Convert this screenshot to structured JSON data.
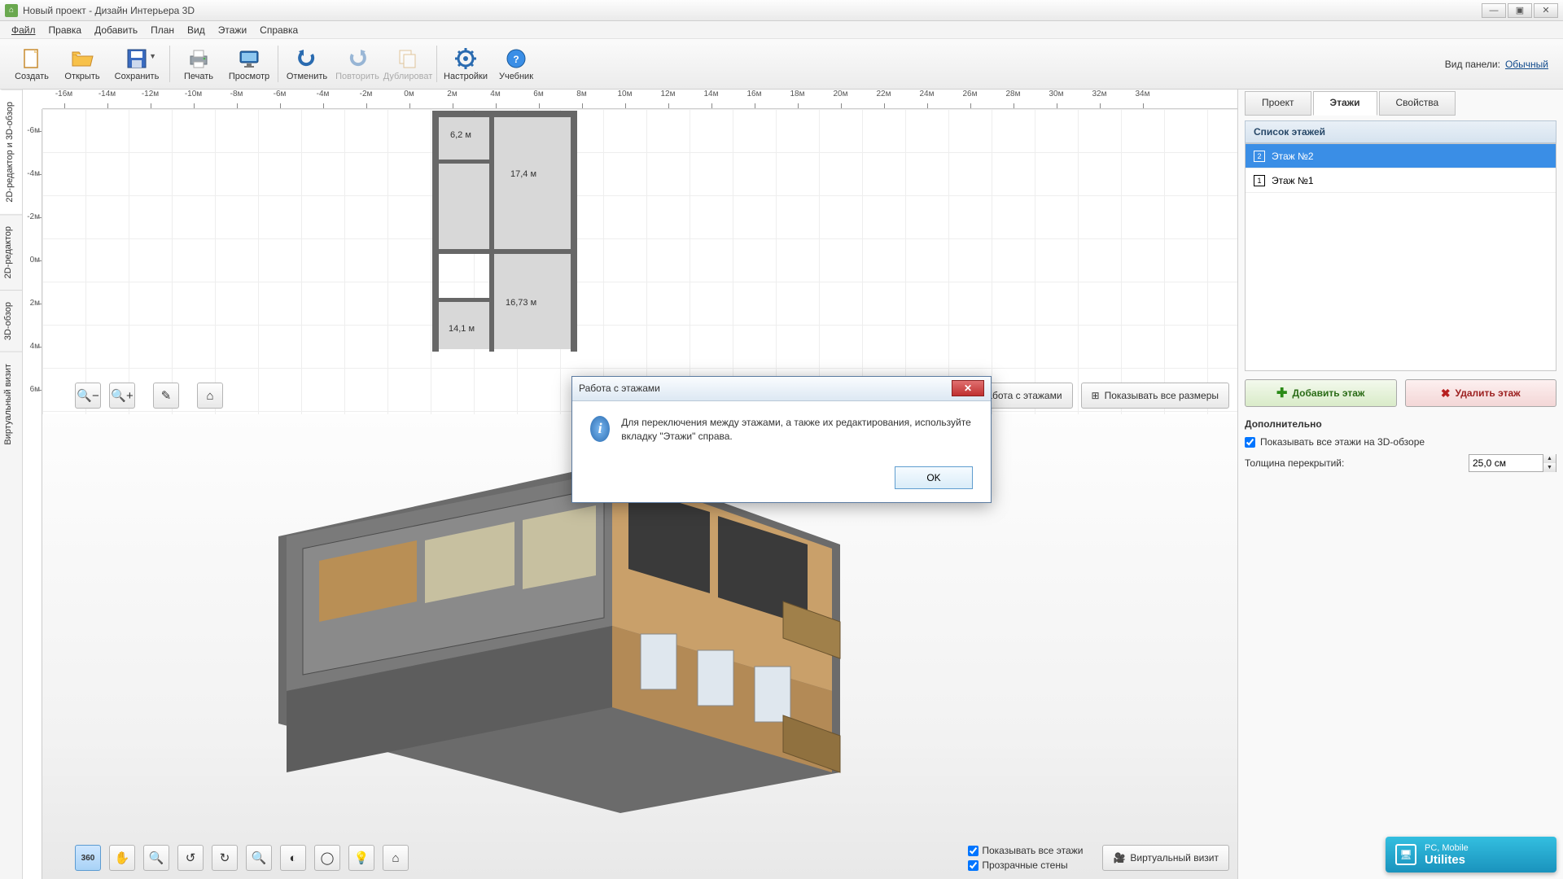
{
  "title": "Новый проект - Дизайн Интерьера 3D",
  "menu": {
    "file": "Файл",
    "edit": "Правка",
    "add": "Добавить",
    "plan": "План",
    "view": "Вид",
    "floors": "Этажи",
    "help": "Справка"
  },
  "toolbar": {
    "create": "Создать",
    "open": "Открыть",
    "save": "Сохранить",
    "print": "Печать",
    "preview": "Просмотр",
    "undo": "Отменить",
    "redo": "Повторить",
    "duplicate": "Дублироват",
    "settings": "Настройки",
    "tutorial": "Учебник",
    "panel_label": "Вид панели:",
    "panel_mode": "Обычный"
  },
  "left_tabs": [
    "2D-редактор и 3D-обзор",
    "2D-редактор",
    "3D-обзор",
    "Виртуальный визит"
  ],
  "ruler_h": [
    "-16м",
    "-14м",
    "-12м",
    "-10м",
    "-8м",
    "-6м",
    "-4м",
    "-2м",
    "0м",
    "2м",
    "4м",
    "6м",
    "8м",
    "10м",
    "12м",
    "14м",
    "16м",
    "18м",
    "20м",
    "22м",
    "24м",
    "26м",
    "28м",
    "30м",
    "32м",
    "34м"
  ],
  "ruler_v": [
    "-6м",
    "-4м",
    "-2м",
    "0м",
    "2м",
    "4м",
    "6м"
  ],
  "rooms": {
    "r1": "6,2 м",
    "r2": "17,4 м",
    "r3": "14,1 м",
    "r4": "16,73 м"
  },
  "overlay2d": {
    "floors_btn": "Работа с этажами",
    "dims_btn": "Показывать все размеры"
  },
  "overlay3d": {
    "show_all": "Показывать все этажи",
    "transparent": "Прозрачные стены",
    "virtual": "Виртуальный визит"
  },
  "right": {
    "tabs": {
      "project": "Проект",
      "floors": "Этажи",
      "props": "Свойства"
    },
    "list_header": "Список этажей",
    "items": [
      {
        "label": "Этаж №2"
      },
      {
        "label": "Этаж №1"
      }
    ],
    "add": "Добавить этаж",
    "del": "Удалить этаж",
    "extra_h": "Дополнительно",
    "show3d": "Показывать все этажи на 3D-обзоре",
    "thickness_label": "Толщина перекрытий:",
    "thickness_value": "25,0 см"
  },
  "dialog": {
    "title": "Работа с этажами",
    "text": "Для переключения между этажами, а также их редактирования, используйте вкладку \"Этажи\" справа.",
    "ok": "OK"
  },
  "util": {
    "line1": "PC, Mobile",
    "line2": "Utilites"
  }
}
